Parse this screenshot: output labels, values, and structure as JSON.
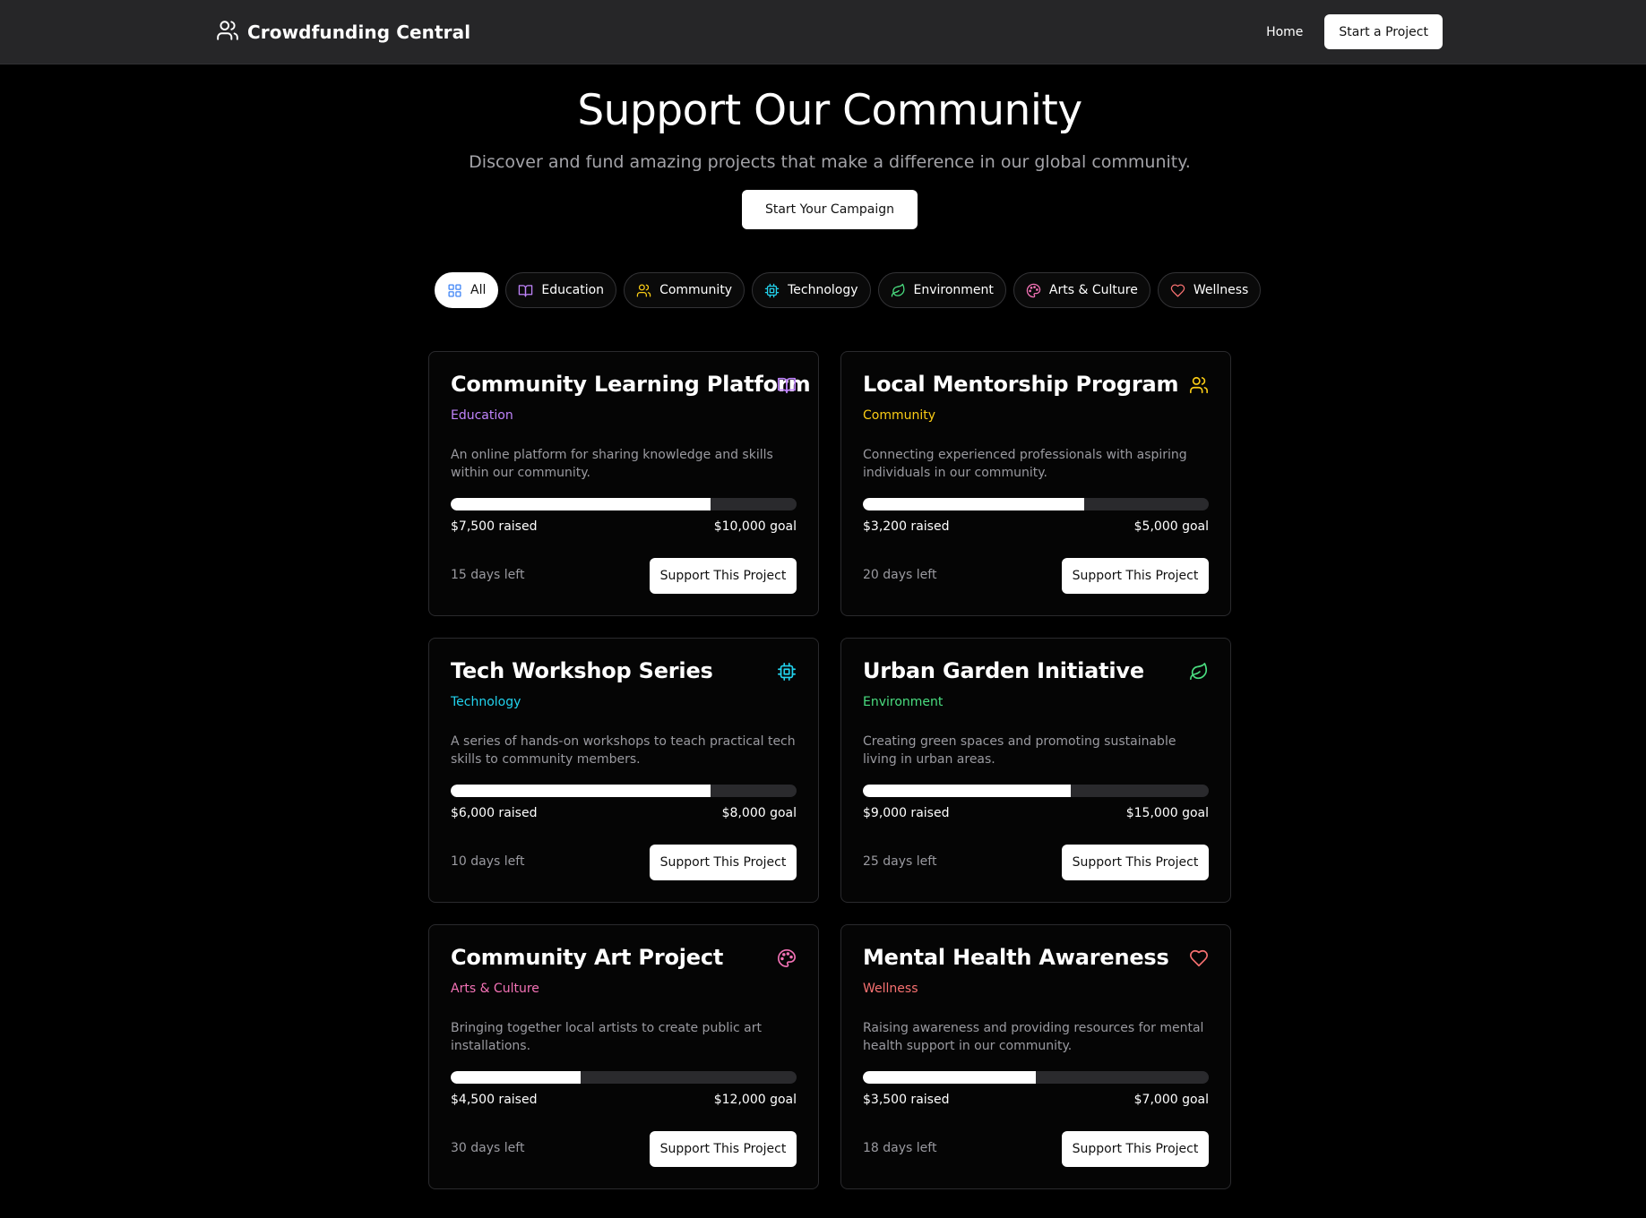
{
  "navbar": {
    "brand": "Crowdfunding Central",
    "home": "Home",
    "start": "Start a Project"
  },
  "hero": {
    "title": "Support Our Community",
    "subtitle": "Discover and fund amazing projects that make a difference in our global community.",
    "cta": "Start Your Campaign"
  },
  "filters": [
    {
      "label": "All",
      "icon": "grid-icon",
      "color": "#3b82f6",
      "active": true
    },
    {
      "label": "Education",
      "icon": "book-icon",
      "color": "#c084fc",
      "active": false
    },
    {
      "label": "Community",
      "icon": "users-icon",
      "color": "#facc15",
      "active": false
    },
    {
      "label": "Technology",
      "icon": "cpu-icon",
      "color": "#22d3ee",
      "active": false
    },
    {
      "label": "Environment",
      "icon": "leaf-icon",
      "color": "#4ade80",
      "active": false
    },
    {
      "label": "Arts & Culture",
      "icon": "palette-icon",
      "color": "#f472b6",
      "active": false
    },
    {
      "label": "Wellness",
      "icon": "heart-icon",
      "color": "#f87171",
      "active": false
    }
  ],
  "projects": [
    {
      "title": "Community Learning Platform",
      "category": "Education",
      "color": "#c084fc",
      "icon": "book-icon",
      "description": "An online platform for sharing knowledge and skills within our community.",
      "raised": "$7,500 raised",
      "goal": "$10,000 goal",
      "progress": 0.75,
      "days": "15 days left",
      "button": "Support This Project"
    },
    {
      "title": "Local Mentorship Program",
      "category": "Community",
      "color": "#facc15",
      "icon": "users-icon",
      "description": "Connecting experienced professionals with aspiring individuals in our community.",
      "raised": "$3,200 raised",
      "goal": "$5,000 goal",
      "progress": 0.64,
      "days": "20 days left",
      "button": "Support This Project"
    },
    {
      "title": "Tech Workshop Series",
      "category": "Technology",
      "color": "#22d3ee",
      "icon": "cpu-icon",
      "description": "A series of hands-on workshops to teach practical tech skills to community members.",
      "raised": "$6,000 raised",
      "goal": "$8,000 goal",
      "progress": 0.75,
      "days": "10 days left",
      "button": "Support This Project"
    },
    {
      "title": "Urban Garden Initiative",
      "category": "Environment",
      "color": "#4ade80",
      "icon": "leaf-icon",
      "description": "Creating green spaces and promoting sustainable living in urban areas.",
      "raised": "$9,000 raised",
      "goal": "$15,000 goal",
      "progress": 0.6,
      "days": "25 days left",
      "button": "Support This Project"
    },
    {
      "title": "Community Art Project",
      "category": "Arts & Culture",
      "color": "#f472b6",
      "icon": "palette-icon",
      "description": "Bringing together local artists to create public art installations.",
      "raised": "$4,500 raised",
      "goal": "$12,000 goal",
      "progress": 0.375,
      "days": "30 days left",
      "button": "Support This Project"
    },
    {
      "title": "Mental Health Awareness",
      "category": "Wellness",
      "color": "#f87171",
      "icon": "heart-icon",
      "description": "Raising awareness and providing resources for mental health support in our community.",
      "raised": "$3,500 raised",
      "goal": "$7,000 goal",
      "progress": 0.5,
      "days": "18 days left",
      "button": "Support This Project"
    }
  ]
}
